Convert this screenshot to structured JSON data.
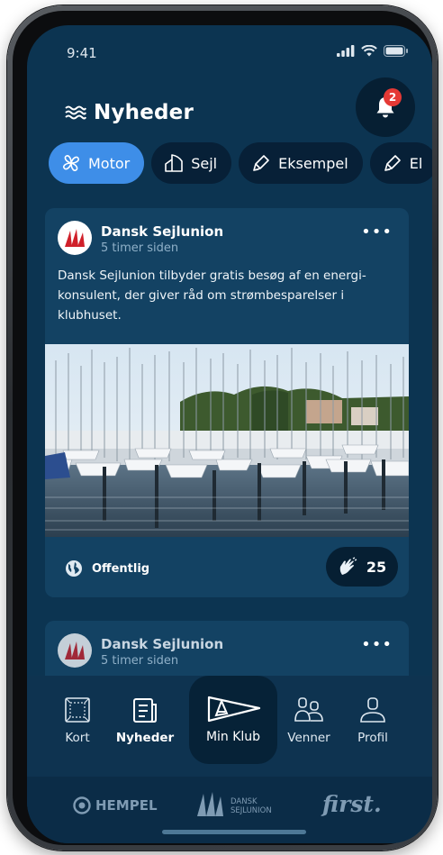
{
  "status": {
    "time": "9:41"
  },
  "header": {
    "title": "Nyheder",
    "notification_count": "2"
  },
  "chips": [
    {
      "label": "Motor",
      "active": true
    },
    {
      "label": "Sejl",
      "active": false
    },
    {
      "label": "Eksempel",
      "active": false
    },
    {
      "label": "El",
      "active": false
    }
  ],
  "posts": [
    {
      "author": "Dansk Sejlunion",
      "time": "5 timer siden",
      "text": "Dansk Sejlunion tilbyder gratis besøg af en energi-konsulent, der giver råd om strømbesparelser i klubhuset.",
      "visibility": "Offentlig",
      "likes": "25"
    },
    {
      "author": "Dansk Sejlunion",
      "time": "5 timer siden"
    }
  ],
  "nav": {
    "kort": "Kort",
    "nyheder": "Nyheder",
    "min_klub": "Min Klub",
    "venner": "Venner",
    "profil": "Profil"
  },
  "sponsors": {
    "hempel": "HEMPEL",
    "dansk_line1": "DANSK",
    "dansk_line2": "SEJLUNION",
    "first": "first."
  },
  "colors": {
    "background": "#0c3451",
    "card": "#134263",
    "accent": "#3e8ee8",
    "badge": "#e53935"
  }
}
